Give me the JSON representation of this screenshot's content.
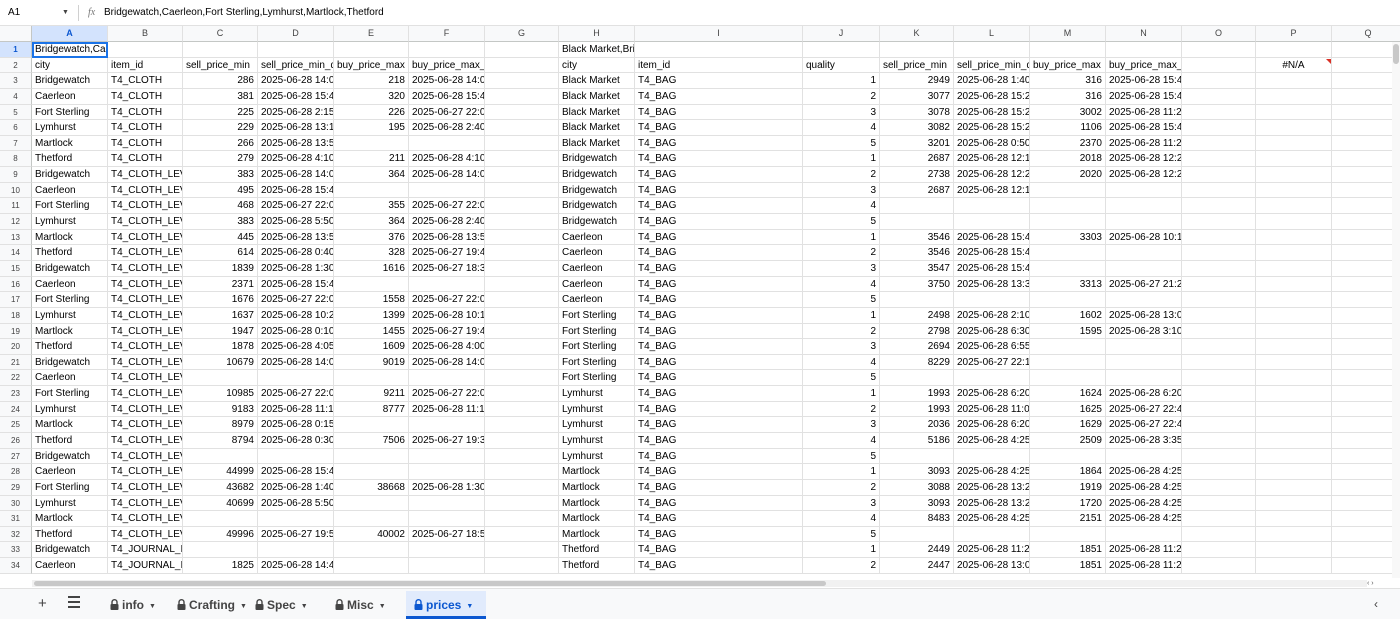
{
  "formula_bar": {
    "name_box": "A1",
    "fx": "fx",
    "content": "Bridgewatch,Caerleon,Fort Sterling,Lymhurst,Martlock,Thetford"
  },
  "columns": [
    "A",
    "B",
    "C",
    "D",
    "E",
    "F",
    "G",
    "H",
    "I",
    "J",
    "K",
    "L",
    "M",
    "N",
    "O",
    "P",
    "Q"
  ],
  "rows": [
    [
      "Bridgewatch,Cae",
      "",
      "",
      "",
      "",
      "",
      "",
      "Black Market,Bri",
      "",
      "",
      "",
      "",
      "",
      "",
      "",
      "",
      ""
    ],
    [
      "city",
      "item_id",
      "sell_price_min",
      "sell_price_min_d",
      "buy_price_max",
      "buy_price_max_",
      "",
      "city",
      "item_id",
      "quality",
      "sell_price_min",
      "sell_price_min_d",
      "buy_price_max",
      "buy_price_max_",
      "",
      "#N/A",
      ""
    ],
    [
      "Bridgewatch",
      "T4_CLOTH",
      "286",
      "2025-06-28 14:0",
      "218",
      "2025-06-28 14:0",
      "",
      "Black Market",
      "T4_BAG",
      "1",
      "2949",
      "2025-06-28 1:40",
      "316",
      "2025-06-28 15:4",
      "",
      "",
      ""
    ],
    [
      "Caerleon",
      "T4_CLOTH",
      "381",
      "2025-06-28 15:4",
      "320",
      "2025-06-28 15:4",
      "",
      "Black Market",
      "T4_BAG",
      "2",
      "3077",
      "2025-06-28 15:2",
      "316",
      "2025-06-28 15:4",
      "",
      "",
      ""
    ],
    [
      "Fort Sterling",
      "T4_CLOTH",
      "225",
      "2025-06-28 2:15",
      "226",
      "2025-06-27 22:0",
      "",
      "Black Market",
      "T4_BAG",
      "3",
      "3078",
      "2025-06-28 15:2",
      "3002",
      "2025-06-28 11:2",
      "",
      "",
      ""
    ],
    [
      "Lymhurst",
      "T4_CLOTH",
      "229",
      "2025-06-28 13:1",
      "195",
      "2025-06-28 2:40",
      "",
      "Black Market",
      "T4_BAG",
      "4",
      "3082",
      "2025-06-28 15:2",
      "1106",
      "2025-06-28 15:4",
      "",
      "",
      ""
    ],
    [
      "Martlock",
      "T4_CLOTH",
      "266",
      "2025-06-28 13:5",
      "",
      "",
      "",
      "Black Market",
      "T4_BAG",
      "5",
      "3201",
      "2025-06-28 0:50",
      "2370",
      "2025-06-28 11:2",
      "",
      "",
      ""
    ],
    [
      "Thetford",
      "T4_CLOTH",
      "279",
      "2025-06-28 4:10",
      "211",
      "2025-06-28 4:10",
      "",
      "Bridgewatch",
      "T4_BAG",
      "1",
      "2687",
      "2025-06-28 12:1",
      "2018",
      "2025-06-28 12:2",
      "",
      "",
      ""
    ],
    [
      "Bridgewatch",
      "T4_CLOTH_LEV",
      "383",
      "2025-06-28 14:0",
      "364",
      "2025-06-28 14:0",
      "",
      "Bridgewatch",
      "T4_BAG",
      "2",
      "2738",
      "2025-06-28 12:2",
      "2020",
      "2025-06-28 12:2",
      "",
      "",
      ""
    ],
    [
      "Caerleon",
      "T4_CLOTH_LEV",
      "495",
      "2025-06-28 15:4",
      "",
      "",
      "",
      "Bridgewatch",
      "T4_BAG",
      "3",
      "2687",
      "2025-06-28 12:1",
      "",
      "",
      "",
      "",
      ""
    ],
    [
      "Fort Sterling",
      "T4_CLOTH_LEV",
      "468",
      "2025-06-27 22:0",
      "355",
      "2025-06-27 22:0",
      "",
      "Bridgewatch",
      "T4_BAG",
      "4",
      "",
      "",
      "",
      "",
      "",
      "",
      ""
    ],
    [
      "Lymhurst",
      "T4_CLOTH_LEV",
      "383",
      "2025-06-28 5:50",
      "364",
      "2025-06-28 2:40",
      "",
      "Bridgewatch",
      "T4_BAG",
      "5",
      "",
      "",
      "",
      "",
      "",
      "",
      ""
    ],
    [
      "Martlock",
      "T4_CLOTH_LEV",
      "445",
      "2025-06-28 13:5",
      "376",
      "2025-06-28 13:5",
      "",
      "Caerleon",
      "T4_BAG",
      "1",
      "3546",
      "2025-06-28 15:4",
      "3303",
      "2025-06-28 10:1",
      "",
      "",
      ""
    ],
    [
      "Thetford",
      "T4_CLOTH_LEV",
      "614",
      "2025-06-28 0:40",
      "328",
      "2025-06-27 19:4",
      "",
      "Caerleon",
      "T4_BAG",
      "2",
      "3546",
      "2025-06-28 15:4",
      "",
      "",
      "",
      "",
      ""
    ],
    [
      "Bridgewatch",
      "T4_CLOTH_LEV",
      "1839",
      "2025-06-28 1:30",
      "1616",
      "2025-06-27 18:3",
      "",
      "Caerleon",
      "T4_BAG",
      "3",
      "3547",
      "2025-06-28 15:4",
      "",
      "",
      "",
      "",
      ""
    ],
    [
      "Caerleon",
      "T4_CLOTH_LEV",
      "2371",
      "2025-06-28 15:4",
      "",
      "",
      "",
      "Caerleon",
      "T4_BAG",
      "4",
      "3750",
      "2025-06-28 13:3",
      "3313",
      "2025-06-27 21:2",
      "",
      "",
      ""
    ],
    [
      "Fort Sterling",
      "T4_CLOTH_LEV",
      "1676",
      "2025-06-27 22:0",
      "1558",
      "2025-06-27 22:0",
      "",
      "Caerleon",
      "T4_BAG",
      "5",
      "",
      "",
      "",
      "",
      "",
      "",
      ""
    ],
    [
      "Lymhurst",
      "T4_CLOTH_LEV",
      "1637",
      "2025-06-28 10:2",
      "1399",
      "2025-06-28 10:1",
      "",
      "Fort Sterling",
      "T4_BAG",
      "1",
      "2498",
      "2025-06-28 2:10",
      "1602",
      "2025-06-28 13:0",
      "",
      "",
      ""
    ],
    [
      "Martlock",
      "T4_CLOTH_LEV",
      "1947",
      "2025-06-28 0:10",
      "1455",
      "2025-06-27 19:4",
      "",
      "Fort Sterling",
      "T4_BAG",
      "2",
      "2798",
      "2025-06-28 6:30",
      "1595",
      "2025-06-28 3:10",
      "",
      "",
      ""
    ],
    [
      "Thetford",
      "T4_CLOTH_LEV",
      "1878",
      "2025-06-28 4:05",
      "1609",
      "2025-06-28 4:00",
      "",
      "Fort Sterling",
      "T4_BAG",
      "3",
      "2694",
      "2025-06-28 6:55",
      "",
      "",
      "",
      "",
      ""
    ],
    [
      "Bridgewatch",
      "T4_CLOTH_LEV",
      "10679",
      "2025-06-28 14:0",
      "9019",
      "2025-06-28 14:0",
      "",
      "Fort Sterling",
      "T4_BAG",
      "4",
      "8229",
      "2025-06-27 22:1",
      "",
      "",
      "",
      "",
      ""
    ],
    [
      "Caerleon",
      "T4_CLOTH_LEV",
      "",
      "",
      "",
      "",
      "",
      "Fort Sterling",
      "T4_BAG",
      "5",
      "",
      "",
      "",
      "",
      "",
      "",
      ""
    ],
    [
      "Fort Sterling",
      "T4_CLOTH_LEV",
      "10985",
      "2025-06-27 22:0",
      "9211",
      "2025-06-27 22:0",
      "",
      "Lymhurst",
      "T4_BAG",
      "1",
      "1993",
      "2025-06-28 6:20",
      "1624",
      "2025-06-28 6:20",
      "",
      "",
      ""
    ],
    [
      "Lymhurst",
      "T4_CLOTH_LEV",
      "9183",
      "2025-06-28 11:1",
      "8777",
      "2025-06-28 11:1",
      "",
      "Lymhurst",
      "T4_BAG",
      "2",
      "1993",
      "2025-06-28 11:0",
      "1625",
      "2025-06-27 22:4",
      "",
      "",
      ""
    ],
    [
      "Martlock",
      "T4_CLOTH_LEV",
      "8979",
      "2025-06-28 0:15",
      "",
      "",
      "",
      "Lymhurst",
      "T4_BAG",
      "3",
      "2036",
      "2025-06-28 6:20",
      "1629",
      "2025-06-27 22:4",
      "",
      "",
      ""
    ],
    [
      "Thetford",
      "T4_CLOTH_LEV",
      "8794",
      "2025-06-28 0:30",
      "7506",
      "2025-06-27 19:3",
      "",
      "Lymhurst",
      "T4_BAG",
      "4",
      "5186",
      "2025-06-28 4:25",
      "2509",
      "2025-06-28 3:35",
      "",
      "",
      ""
    ],
    [
      "Bridgewatch",
      "T4_CLOTH_LEV",
      "",
      "",
      "",
      "",
      "",
      "Lymhurst",
      "T4_BAG",
      "5",
      "",
      "",
      "",
      "",
      "",
      "",
      ""
    ],
    [
      "Caerleon",
      "T4_CLOTH_LEV",
      "44999",
      "2025-06-28 15:4",
      "",
      "",
      "",
      "Martlock",
      "T4_BAG",
      "1",
      "3093",
      "2025-06-28 4:25",
      "1864",
      "2025-06-28 4:25",
      "",
      "",
      ""
    ],
    [
      "Fort Sterling",
      "T4_CLOTH_LEV",
      "43682",
      "2025-06-28 1:40",
      "38668",
      "2025-06-28 1:30",
      "",
      "Martlock",
      "T4_BAG",
      "2",
      "3088",
      "2025-06-28 13:2",
      "1919",
      "2025-06-28 4:25",
      "",
      "",
      ""
    ],
    [
      "Lymhurst",
      "T4_CLOTH_LEV",
      "40699",
      "2025-06-28 5:50",
      "",
      "",
      "",
      "Martlock",
      "T4_BAG",
      "3",
      "3093",
      "2025-06-28 13:2",
      "1720",
      "2025-06-28 4:25",
      "",
      "",
      ""
    ],
    [
      "Martlock",
      "T4_CLOTH_LEV",
      "",
      "",
      "",
      "",
      "",
      "Martlock",
      "T4_BAG",
      "4",
      "8483",
      "2025-06-28 4:25",
      "2151",
      "2025-06-28 4:25",
      "",
      "",
      ""
    ],
    [
      "Thetford",
      "T4_CLOTH_LEV",
      "49996",
      "2025-06-27 19:5",
      "40002",
      "2025-06-27 18:5",
      "",
      "Martlock",
      "T4_BAG",
      "5",
      "",
      "",
      "",
      "",
      "",
      "",
      ""
    ],
    [
      "Bridgewatch",
      "T4_JOURNAL_I",
      "",
      "",
      "",
      "",
      "",
      "Thetford",
      "T4_BAG",
      "1",
      "2449",
      "2025-06-28 11:2",
      "1851",
      "2025-06-28 11:2",
      "",
      "",
      ""
    ],
    [
      "Caerleon",
      "T4_JOURNAL_I",
      "1825",
      "2025-06-28 14:4",
      "",
      "",
      "",
      "Thetford",
      "T4_BAG",
      "2",
      "2447",
      "2025-06-28 13:0",
      "1851",
      "2025-06-28 11:2",
      "",
      "",
      ""
    ]
  ],
  "sheets": [
    {
      "label": "info",
      "locked": true,
      "active": false
    },
    {
      "label": "Crafting",
      "locked": true,
      "active": false
    },
    {
      "label": "Spec",
      "locked": true,
      "active": false
    },
    {
      "label": "Misc",
      "locked": true,
      "active": false
    },
    {
      "label": "prices",
      "locked": true,
      "active": true
    }
  ],
  "colors": {
    "accent": "#0b57d0",
    "selection": "#1a73e8",
    "header_bg": "#f8f9fa",
    "error_flag": "#d93025"
  },
  "icons": {
    "add_sheet": "plus-icon",
    "all_sheets": "hamburger-icon",
    "sheet_lock": "lock-icon",
    "sheet_menu": "caret-down-icon",
    "explore": "chevron-left-icon"
  }
}
